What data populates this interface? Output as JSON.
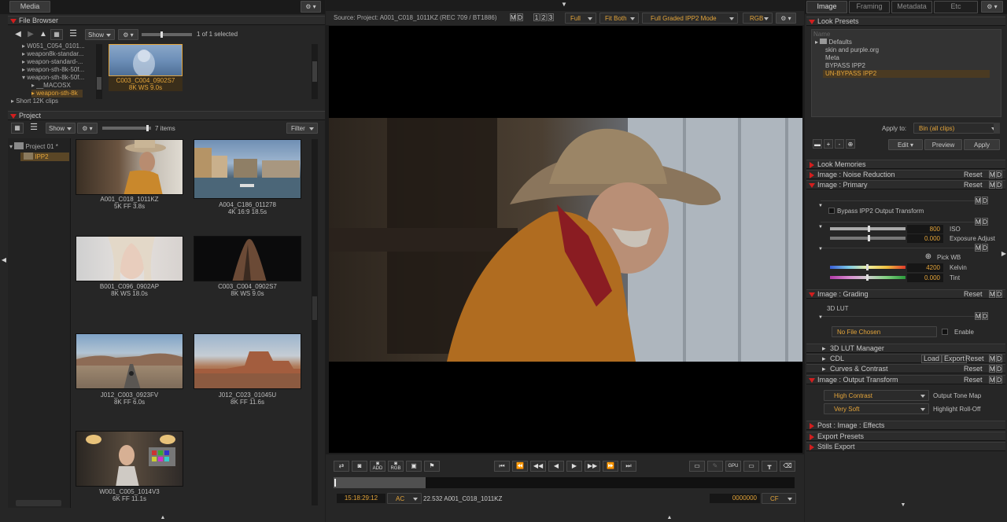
{
  "left": {
    "tab_media": "Media",
    "file_browser": {
      "title": "File Browser",
      "show_label": "Show",
      "selection_count": "1 of 1 selected",
      "tree": [
        "W051_C054_0101...",
        "weapon8k-standar...",
        "weapon-standard-...",
        "weapon-sth-8k-50f...",
        "weapon-sth-8k-50f...",
        "__MACOSX",
        "weapon-sth-8k",
        "Short 12K clips"
      ],
      "selected_clip": {
        "name": "C003_C004_0902S7",
        "meta": "8K WS  9.0s"
      }
    },
    "project": {
      "title": "Project",
      "show_label": "Show",
      "filter_label": "Filter",
      "item_count": "7 items",
      "tree": [
        "Project 01 *",
        "IPP2"
      ],
      "clips": [
        {
          "name": "A001_C018_1011KZ",
          "meta": "5K FF  3.8s"
        },
        {
          "name": "A004_C186_011278",
          "meta": "4K 16:9  18.5s"
        },
        {
          "name": "B001_C096_0902AP",
          "meta": "8K WS  18.0s"
        },
        {
          "name": "C003_C004_0902S7",
          "meta": "8K WS  9.0s"
        },
        {
          "name": "J012_C003_0923FV",
          "meta": "8K FF  6.0s"
        },
        {
          "name": "J012_C023_01045U",
          "meta": "8K FF  11.6s"
        },
        {
          "name": "W001_C005_1014V3",
          "meta": "6K FF  11.1s"
        }
      ]
    }
  },
  "viewer": {
    "source_label": "Source: Project: A001_C018_1011KZ   (REC 709 / BT1886)",
    "md_m": "M",
    "md_d": "D",
    "view_slots": [
      "1",
      "2",
      "3"
    ],
    "resolution": "Full",
    "fit": "Fit Both",
    "mode": "Full Graded IPP2 Mode",
    "channel": "RGB",
    "timecode": "15:18:29:12",
    "tc_mode": "AC",
    "clip_info": "22.532 A001_C018_1011KZ",
    "frame_counter": "0000000",
    "frame_mode": "CF",
    "progress": 0.2,
    "transport_labels": {
      "add": "ADD",
      "rgb": "RGB",
      "gpu": "GPU"
    }
  },
  "right": {
    "tabs": [
      "Image",
      "Framing",
      "Metadata",
      "Etc"
    ],
    "look_presets": {
      "title": "Look Presets",
      "name_placeholder": "Name",
      "items": [
        "Defaults",
        "skin and purple.org",
        "Meta",
        "BYPASS IPP2",
        "UN-BYPASS IPP2"
      ],
      "apply_to_label": "Apply to:",
      "apply_to_value": "Bin (all clips)",
      "edit": "Edit",
      "preview": "Preview",
      "apply": "Apply"
    },
    "sections": {
      "look_memories": "Look Memories",
      "noise_reduction": "Image : Noise Reduction",
      "primary": "Image : Primary",
      "grading": "Image : Grading",
      "lut_manager": "3D LUT Manager",
      "cdl": "CDL",
      "curves": "Curves & Contrast",
      "output_transform": "Image : Output Transform",
      "post_effects": "Post : Image : Effects",
      "export_presets": "Export Presets",
      "stills_export": "Stills Export"
    },
    "reset": "Reset",
    "load": "Load",
    "export": "Export",
    "primary": {
      "bypass_label": "Bypass IPP2 Output Transform",
      "iso_value": "800",
      "iso_label": "ISO",
      "exposure_value": "0.000",
      "exposure_label": "Exposure Adjust",
      "pick_wb": "Pick WB",
      "kelvin_value": "4200",
      "kelvin_label": "Kelvin",
      "tint_value": "0.000",
      "tint_label": "Tint"
    },
    "grading": {
      "lut_label": "3D LUT",
      "lut_file": "No File Chosen",
      "enable": "Enable"
    },
    "output": {
      "tone_map_value": "High Contrast",
      "tone_map_label": "Output Tone Map",
      "rolloff_value": "Very Soft",
      "rolloff_label": "Highlight Roll-Off"
    }
  }
}
